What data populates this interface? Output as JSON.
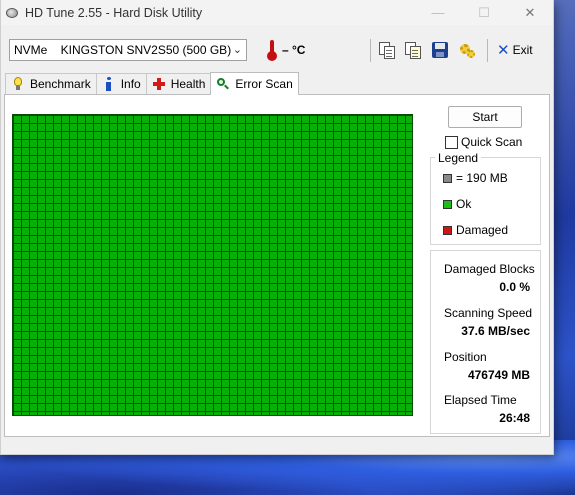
{
  "window": {
    "title": "HD Tune 2.55 - Hard Disk Utility",
    "controls": {
      "minimize": "—",
      "maximize": "☐",
      "close": "✕"
    }
  },
  "toolbar": {
    "drive_select": "NVMe    KINGSTON SNV2S50 (500 GB)",
    "temperature": "– °C",
    "icons": [
      "copy-info-icon",
      "copy-screenshot-icon",
      "save-icon",
      "options-icon"
    ],
    "exit_label": "Exit"
  },
  "tabs": [
    {
      "label": "Benchmark",
      "icon": "lightbulb-icon"
    },
    {
      "label": "Info",
      "icon": "info-icon"
    },
    {
      "label": "Health",
      "icon": "health-cross-icon"
    },
    {
      "label": "Error Scan",
      "icon": "magnifier-icon",
      "active": true
    }
  ],
  "error_scan": {
    "start_label": "Start",
    "quick_scan_label": "Quick Scan",
    "quick_scan_checked": false,
    "legend": {
      "title": "Legend",
      "items": [
        {
          "label": "= 190 MB",
          "color": "#8a8a8a"
        },
        {
          "label": "Ok",
          "color": "#18c018"
        },
        {
          "label": "Damaged",
          "color": "#d01515"
        }
      ]
    },
    "stats": {
      "damaged_blocks_label": "Damaged Blocks",
      "damaged_blocks_value": "0.0 %",
      "scanning_speed_label": "Scanning Speed",
      "scanning_speed_value": "37.6 MB/sec",
      "position_label": "Position",
      "position_value": "476749 MB",
      "elapsed_time_label": "Elapsed Time",
      "elapsed_time_value": "26:48"
    },
    "block_status": "all ok",
    "block_color": "#06b006"
  }
}
